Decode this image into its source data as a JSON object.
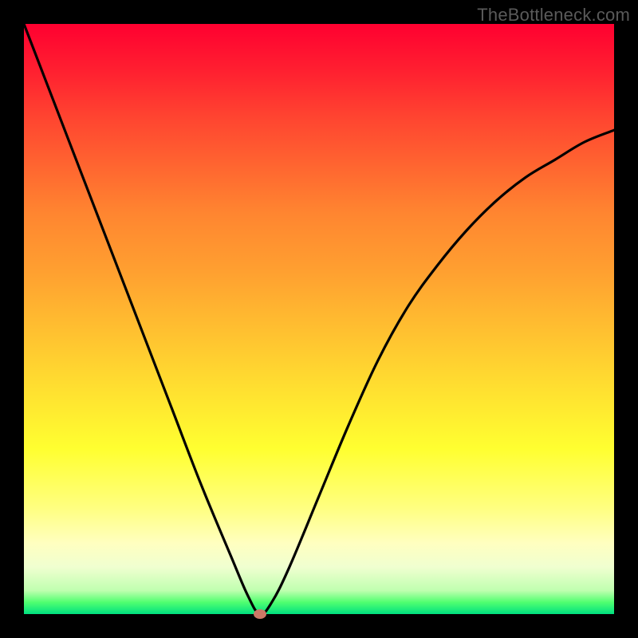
{
  "watermark": "TheBottleneck.com",
  "chart_data": {
    "type": "line",
    "title": "",
    "xlabel": "",
    "ylabel": "",
    "xlim": [
      0,
      100
    ],
    "ylim": [
      0,
      100
    ],
    "grid": false,
    "series": [
      {
        "name": "bottleneck-curve",
        "x": [
          0,
          5,
          10,
          15,
          20,
          25,
          30,
          35,
          38,
          40,
          42,
          45,
          50,
          55,
          60,
          65,
          70,
          75,
          80,
          85,
          90,
          95,
          100
        ],
        "values": [
          100,
          87,
          74,
          61,
          48,
          35,
          22,
          10,
          3,
          0,
          2,
          8,
          20,
          32,
          43,
          52,
          59,
          65,
          70,
          74,
          77,
          80,
          82
        ]
      }
    ],
    "marker": {
      "x": 40,
      "y": 0,
      "color": "#cc7766"
    },
    "background_gradient": {
      "top": "#ff0030",
      "bottom": "#00e080"
    }
  }
}
